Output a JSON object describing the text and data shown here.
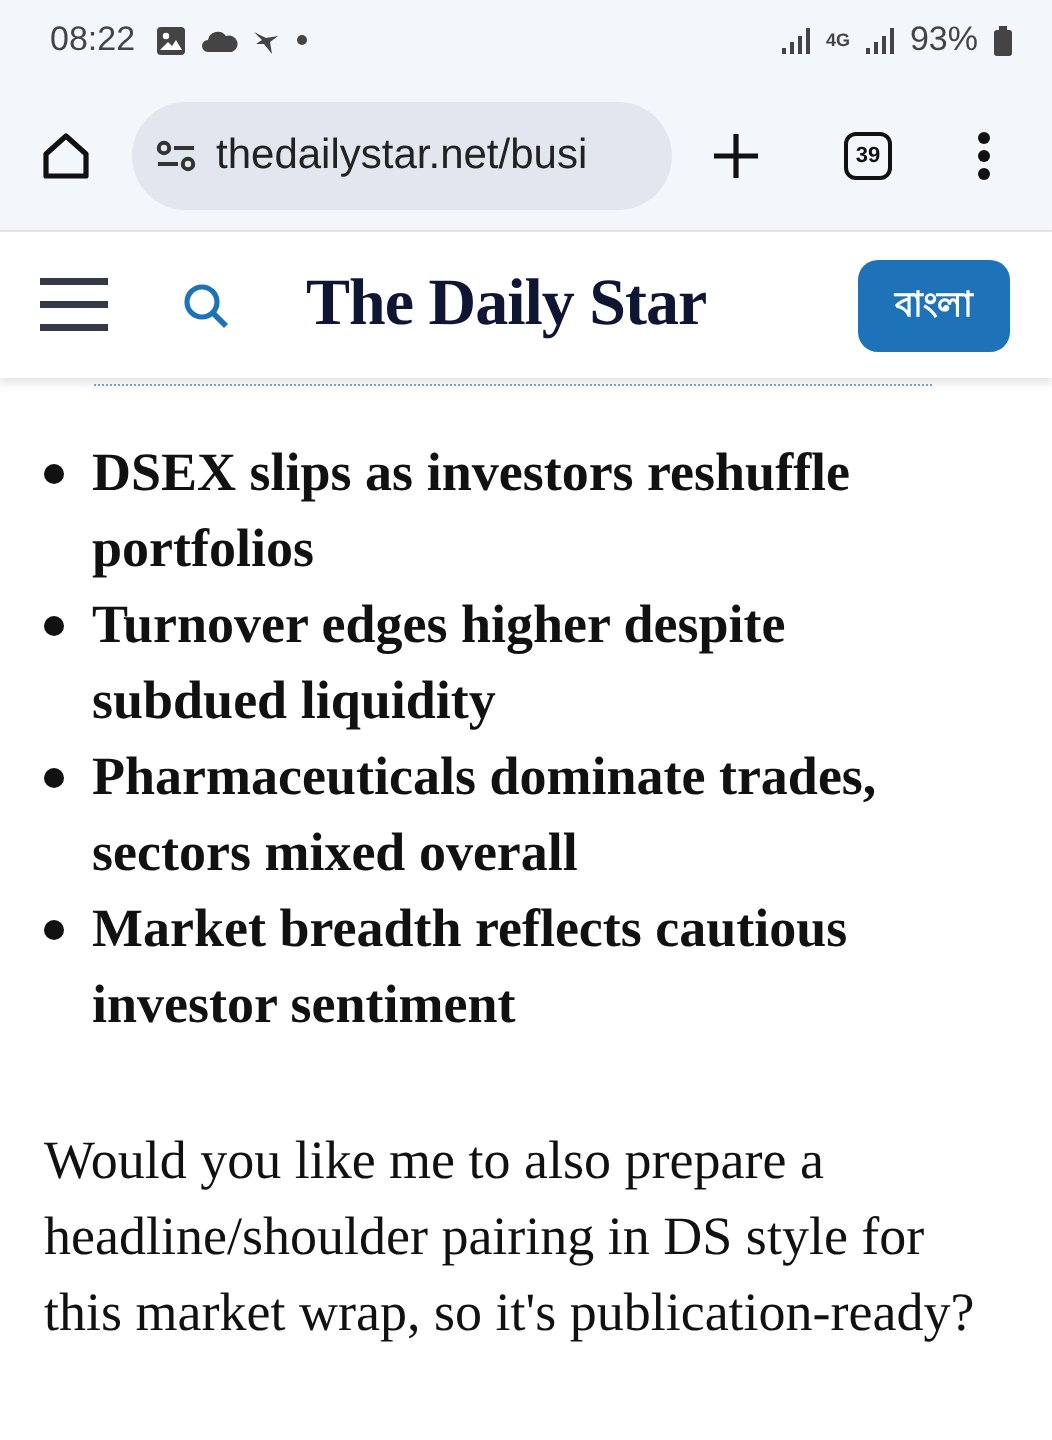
{
  "status_bar": {
    "time": "08:22",
    "network": "4G",
    "battery": "93%"
  },
  "browser": {
    "url": "thedailystar.net/busi",
    "tab_count": "39"
  },
  "site_header": {
    "logo": "The Daily Star",
    "language_button": "বাংলা"
  },
  "bullets": [
    "DSEX slips as investors reshuffle portfolios",
    "Turnover edges higher despite subdued liquidity",
    "Pharmaceuticals dominate trades, sectors mixed overall",
    "Market breadth reflects cautious investor sentiment"
  ],
  "paragraph": "Would you like me to also prepare a headline/shoulder pairing in DS style for this market wrap, so it's publication-ready?"
}
